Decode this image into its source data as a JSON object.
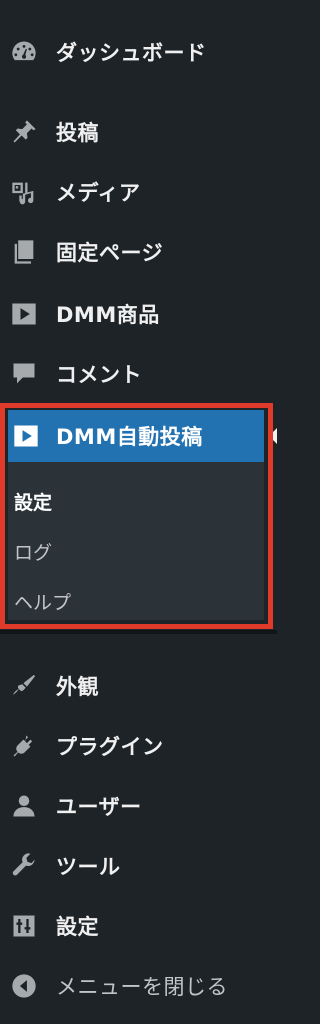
{
  "menu": {
    "items": [
      {
        "label": "ダッシュボード",
        "icon": "dashboard-icon"
      },
      {
        "label": "投稿",
        "icon": "pin-icon"
      },
      {
        "label": "メディア",
        "icon": "media-icon"
      },
      {
        "label": "固定ページ",
        "icon": "page-icon"
      },
      {
        "label": "DMM商品",
        "icon": "play-icon"
      },
      {
        "label": "コメント",
        "icon": "comment-icon"
      }
    ],
    "active": {
      "label": "DMM自動投稿",
      "icon": "play-icon"
    },
    "submenu": [
      {
        "label": "設定"
      },
      {
        "label": "ログ"
      },
      {
        "label": "ヘルプ"
      }
    ],
    "items_after": [
      {
        "label": "外観",
        "icon": "brush-icon"
      },
      {
        "label": "プラグイン",
        "icon": "plug-icon"
      },
      {
        "label": "ユーザー",
        "icon": "user-icon"
      },
      {
        "label": "ツール",
        "icon": "wrench-icon"
      },
      {
        "label": "設定",
        "icon": "settings-icon"
      }
    ],
    "collapse": {
      "label": "メニューを閉じる",
      "icon": "collapse-icon"
    }
  },
  "colors": {
    "background": "#1d2327",
    "active": "#2271b1",
    "submenu": "#2c3338",
    "highlight": "#e03a2a"
  }
}
